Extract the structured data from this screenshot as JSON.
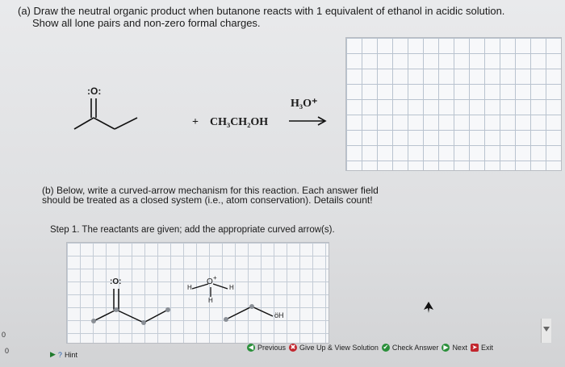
{
  "part_a": {
    "line1": "(a) Draw the neutral organic product when butanone reacts with 1 equivalent of ethanol in acidic solution.",
    "line2": "Show all lone pairs and non-zero formal charges."
  },
  "reaction": {
    "oxygen_label": ":O:",
    "plus": "+",
    "reagent": "CH₃CH₂OH",
    "catalyst": "H₃O⁺"
  },
  "part_b": {
    "line1": "(b) Below, write a curved-arrow mechanism for this reaction. Each answer field",
    "line2": "should be treated as a closed system (i.e., atom conservation). Details count!"
  },
  "step1": "Step 1. The reactants are given; add the appropriate curved arrow(s).",
  "mechanism": {
    "ketone_o": ":O:",
    "hydronium_o": "O",
    "hydronium_charge": "+",
    "h_left": "H",
    "h_right": "H",
    "h_bottom": "H",
    "ethanol_oh": "öH"
  },
  "toolbar": {
    "previous": "Previous",
    "give_up": "Give Up & View Solution",
    "check": "Check Answer",
    "next": "Next",
    "exit": "Exit"
  },
  "hint": "Hint",
  "edge_numbers": [
    "0",
    "0"
  ],
  "colors": {
    "previous_icon": "#2a8f3a",
    "give_up_icon": "#c2262e",
    "check_icon": "#2a8f3a",
    "next_icon": "#2a8f3a",
    "exit_icon": "#c2262e"
  }
}
